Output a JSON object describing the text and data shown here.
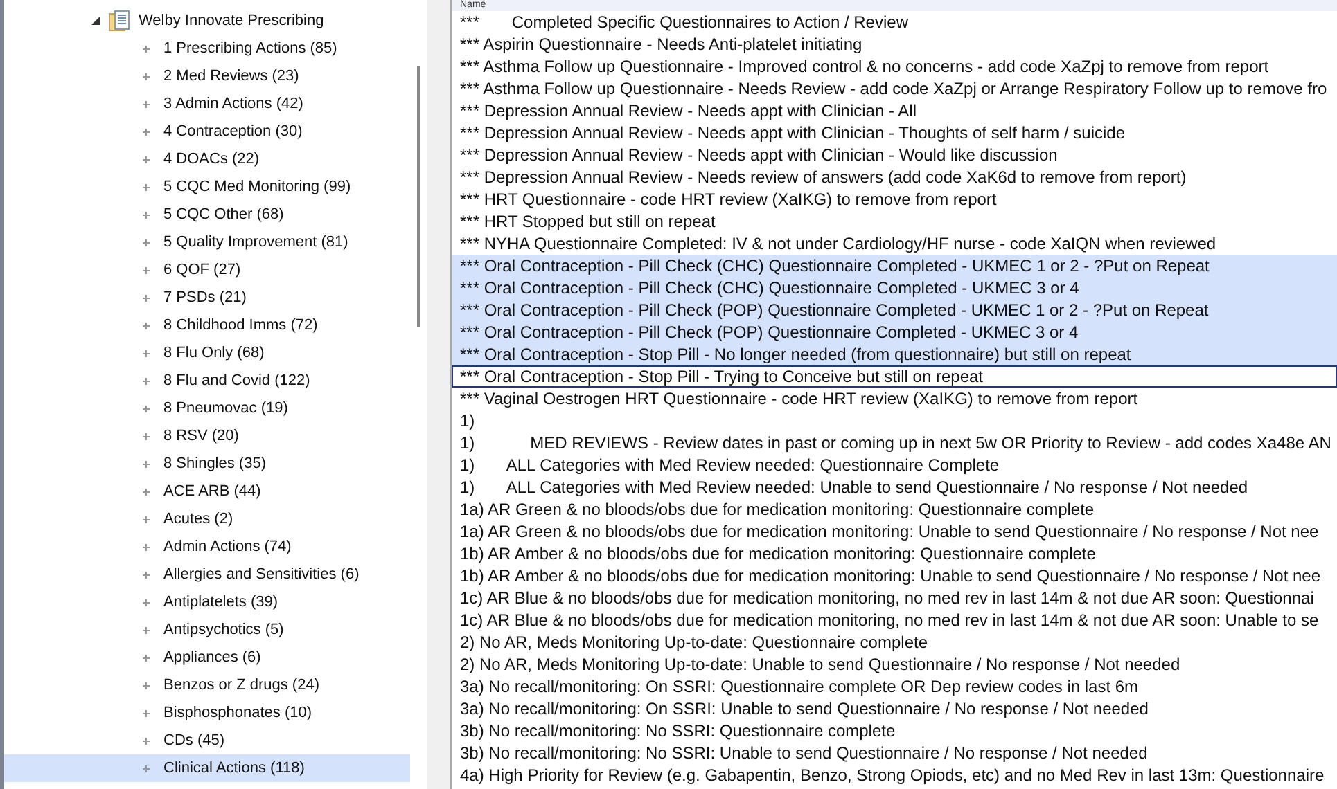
{
  "tree": {
    "parent": {
      "label": "Welby Innovate Prescribing",
      "expanded": true
    },
    "items": [
      {
        "label": "1 Prescribing Actions (85)",
        "selected": false
      },
      {
        "label": "2 Med Reviews (23)",
        "selected": false
      },
      {
        "label": "3 Admin Actions (42)",
        "selected": false
      },
      {
        "label": "4 Contraception (30)",
        "selected": false
      },
      {
        "label": "4 DOACs (22)",
        "selected": false
      },
      {
        "label": "5 CQC Med Monitoring (99)",
        "selected": false
      },
      {
        "label": "5 CQC Other (68)",
        "selected": false
      },
      {
        "label": "5 Quality Improvement (81)",
        "selected": false
      },
      {
        "label": "6 QOF (27)",
        "selected": false
      },
      {
        "label": "7 PSDs (21)",
        "selected": false
      },
      {
        "label": "8 Childhood Imms (72)",
        "selected": false
      },
      {
        "label": "8 Flu Only (68)",
        "selected": false
      },
      {
        "label": "8 Flu and Covid (122)",
        "selected": false
      },
      {
        "label": "8 Pneumovac (19)",
        "selected": false
      },
      {
        "label": "8 RSV (20)",
        "selected": false
      },
      {
        "label": "8 Shingles (35)",
        "selected": false
      },
      {
        "label": "ACE ARB (44)",
        "selected": false
      },
      {
        "label": "Acutes (2)",
        "selected": false
      },
      {
        "label": "Admin Actions (74)",
        "selected": false
      },
      {
        "label": "Allergies and Sensitivities (6)",
        "selected": false
      },
      {
        "label": "Antiplatelets (39)",
        "selected": false
      },
      {
        "label": "Antipsychotics (5)",
        "selected": false
      },
      {
        "label": "Appliances (6)",
        "selected": false
      },
      {
        "label": "Benzos or Z drugs (24)",
        "selected": false
      },
      {
        "label": "Bisphosphonates (10)",
        "selected": false
      },
      {
        "label": "CDs (45)",
        "selected": false
      },
      {
        "label": "Clinical Actions (118)",
        "selected": true
      }
    ]
  },
  "list": {
    "column": "Name",
    "rows": [
      {
        "text": "***       Completed Specific Questionnaires to Action / Review",
        "selected": false,
        "focused": false
      },
      {
        "text": "*** Aspirin Questionnaire - Needs Anti-platelet initiating",
        "selected": false,
        "focused": false
      },
      {
        "text": "*** Asthma Follow up Questionnaire - Improved control & no concerns - add code XaZpj to remove from report",
        "selected": false,
        "focused": false
      },
      {
        "text": "*** Asthma Follow up Questionnaire - Needs Review - add code XaZpj or Arrange Respiratory Follow up to remove fro",
        "selected": false,
        "focused": false
      },
      {
        "text": "*** Depression Annual Review - Needs appt with Clinician - All",
        "selected": false,
        "focused": false
      },
      {
        "text": "*** Depression Annual Review - Needs appt with Clinician - Thoughts of self harm / suicide",
        "selected": false,
        "focused": false
      },
      {
        "text": "*** Depression Annual Review - Needs appt with Clinician - Would like discussion",
        "selected": false,
        "focused": false
      },
      {
        "text": "*** Depression Annual Review - Needs review of answers (add code XaK6d to remove from report)",
        "selected": false,
        "focused": false
      },
      {
        "text": "*** HRT Questionnaire - code HRT review (XaIKG) to remove from report",
        "selected": false,
        "focused": false
      },
      {
        "text": "*** HRT Stopped but still on repeat",
        "selected": false,
        "focused": false
      },
      {
        "text": "*** NYHA Questionnaire Completed: IV & not under Cardiology/HF nurse - code XaIQN when reviewed",
        "selected": false,
        "focused": false
      },
      {
        "text": "*** Oral Contraception - Pill Check (CHC) Questionnaire Completed - UKMEC 1 or 2 - ?Put on Repeat",
        "selected": true,
        "focused": false
      },
      {
        "text": "*** Oral Contraception - Pill Check (CHC) Questionnaire Completed - UKMEC 3 or 4",
        "selected": true,
        "focused": false
      },
      {
        "text": "*** Oral Contraception - Pill Check (POP) Questionnaire Completed - UKMEC 1 or 2 - ?Put on Repeat",
        "selected": true,
        "focused": false
      },
      {
        "text": "*** Oral Contraception - Pill Check (POP) Questionnaire Completed - UKMEC 3 or 4",
        "selected": true,
        "focused": false
      },
      {
        "text": "*** Oral Contraception - Stop Pill - No longer needed (from questionnaire) but still on repeat",
        "selected": true,
        "focused": false
      },
      {
        "text": "*** Oral Contraception - Stop Pill - Trying to Conceive but still on repeat",
        "selected": false,
        "focused": true
      },
      {
        "text": "*** Vaginal Oestrogen HRT Questionnaire - code HRT review (XaIKG) to remove from report",
        "selected": false,
        "focused": false
      },
      {
        "text": "1)",
        "selected": false,
        "focused": false
      },
      {
        "text": "1)            MED REVIEWS - Review dates in past or coming up in next 5w OR Priority to Review - add codes Xa48e AN",
        "selected": false,
        "focused": false
      },
      {
        "text": "1)       ALL Categories with Med Review needed: Questionnaire Complete",
        "selected": false,
        "focused": false
      },
      {
        "text": "1)       ALL Categories with Med Review needed: Unable to send Questionnaire / No response / Not needed",
        "selected": false,
        "focused": false
      },
      {
        "text": "1a) AR Green & no bloods/obs due for medication monitoring: Questionnaire complete",
        "selected": false,
        "focused": false
      },
      {
        "text": "1a) AR Green & no bloods/obs due for medication monitoring: Unable to send Questionnaire / No response / Not nee",
        "selected": false,
        "focused": false
      },
      {
        "text": "1b) AR Amber & no bloods/obs due for medication monitoring: Questionnaire complete",
        "selected": false,
        "focused": false
      },
      {
        "text": "1b) AR Amber & no bloods/obs due for medication monitoring: Unable to send Questionnaire / No response / Not nee",
        "selected": false,
        "focused": false
      },
      {
        "text": "1c) AR Blue & no bloods/obs due for medication monitoring, no med rev in last 14m & not due AR soon: Questionnai",
        "selected": false,
        "focused": false
      },
      {
        "text": "1c) AR Blue & no bloods/obs due for medication monitoring, no med rev in last 14m & not due AR soon: Unable to se",
        "selected": false,
        "focused": false
      },
      {
        "text": "2) No AR, Meds Monitoring Up-to-date: Questionnaire complete",
        "selected": false,
        "focused": false
      },
      {
        "text": "2) No AR, Meds Monitoring Up-to-date: Unable to send Questionnaire / No response / Not needed",
        "selected": false,
        "focused": false
      },
      {
        "text": "3a) No recall/monitoring: On SSRI: Questionnaire complete OR Dep review codes in last 6m",
        "selected": false,
        "focused": false
      },
      {
        "text": "3a) No recall/monitoring: On SSRI: Unable to send Questionnaire / No response / Not needed",
        "selected": false,
        "focused": false
      },
      {
        "text": "3b) No recall/monitoring: No SSRI: Questionnaire complete",
        "selected": false,
        "focused": false
      },
      {
        "text": "3b) No recall/monitoring: No SSRI: Unable to send Questionnaire / No response / Not needed",
        "selected": false,
        "focused": false
      },
      {
        "text": "4a) High Priority for Review (e.g. Gabapentin, Benzo, Strong Opiods, etc) and no Med Rev in last 13m: Questionnaire",
        "selected": false,
        "focused": false
      }
    ]
  }
}
